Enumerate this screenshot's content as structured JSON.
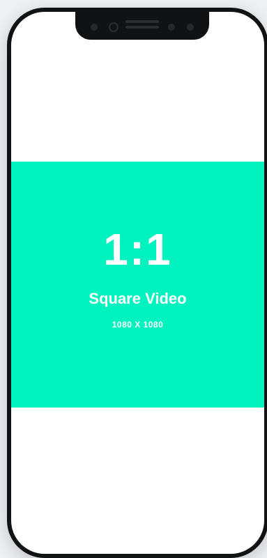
{
  "video_preview": {
    "ratio": "1:1",
    "format_label": "Square Video",
    "dimensions": "1080 X 1080",
    "accent_color": "#00f2be"
  },
  "device": {
    "frame_color": "#111214",
    "screen_color": "#ffffff",
    "icons": [
      "camera-icon",
      "speaker-grille-icon",
      "sensor-icon"
    ]
  }
}
